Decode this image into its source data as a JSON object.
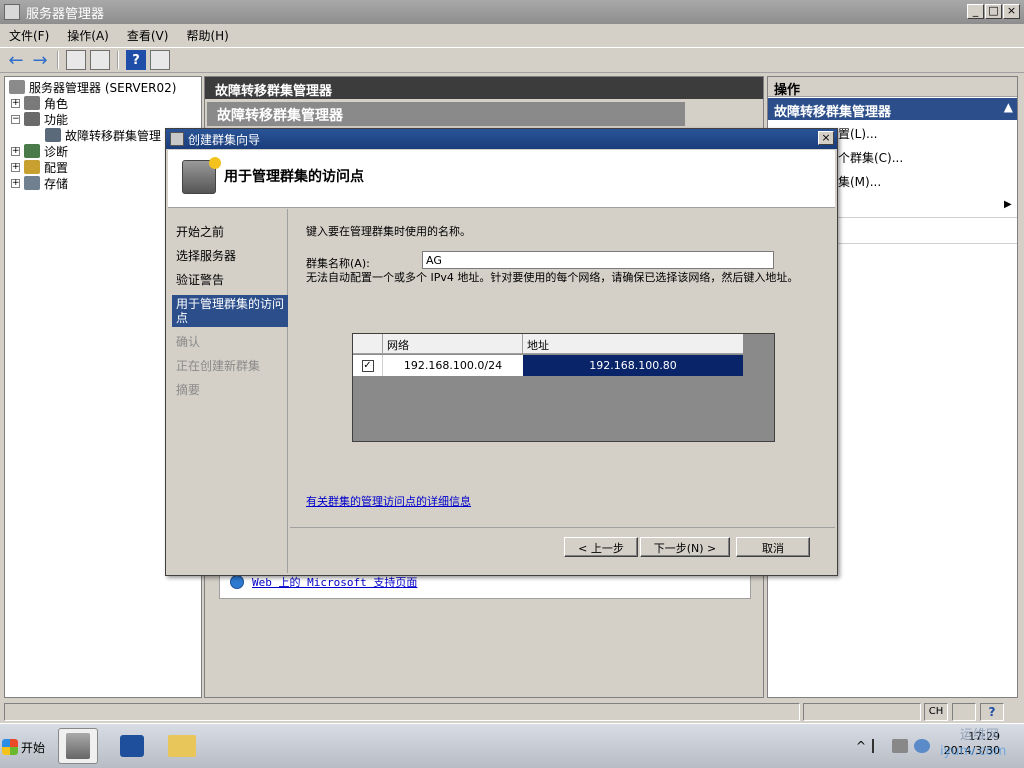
{
  "window": {
    "title": "服务器管理器",
    "controls": {
      "minimize": "_",
      "restore": "□",
      "close": "×"
    }
  },
  "menubar": {
    "items": [
      {
        "label": "文件(F)"
      },
      {
        "label": "操作(A)"
      },
      {
        "label": "查看(V)"
      },
      {
        "label": "帮助(H)"
      }
    ]
  },
  "toolbar": {
    "back_icon": "←",
    "forward_icon": "→",
    "help_icon": "?"
  },
  "tree": {
    "root": "服务器管理器 (SERVER02)",
    "items": [
      {
        "label": "角色",
        "expander": "+"
      },
      {
        "label": "功能",
        "expander": "−"
      },
      {
        "label": "故障转移群集管理",
        "expander": ""
      },
      {
        "label": "诊断",
        "expander": "+"
      },
      {
        "label": "配置",
        "expander": "+"
      },
      {
        "label": "存储",
        "expander": "+"
      }
    ]
  },
  "center": {
    "header": "故障转移群集管理器",
    "subheader": "故障转移群集管理器",
    "web_link": "Web 上的 Microsoft 支持页面"
  },
  "actions": {
    "header": "操作",
    "section": "故障转移群集管理器",
    "collapse_icon": "▲",
    "items": [
      {
        "label": "置(L)..."
      },
      {
        "label": "个群集(C)..."
      },
      {
        "label": "集(M)..."
      }
    ],
    "submenu_arrow": "▶"
  },
  "wizard": {
    "title": "创建群集向导",
    "close": "×",
    "header_title": "用于管理群集的访问点",
    "steps": [
      {
        "label": "开始之前"
      },
      {
        "label": "选择服务器"
      },
      {
        "label": "验证警告"
      },
      {
        "label": "用于管理群集的访问点"
      },
      {
        "label": "确认"
      },
      {
        "label": "正在创建新群集"
      },
      {
        "label": "摘要"
      }
    ],
    "instruction": "键入要在管理群集时使用的名称。",
    "name_label": "群集名称(A):",
    "name_value": "AG",
    "note": "无法自动配置一个或多个 IPv4 地址。针对要使用的每个网络，请确保已选择该网络，然后键入地址。",
    "table": {
      "columns": [
        "网络",
        "地址"
      ],
      "rows": [
        {
          "checked": "✓",
          "network": "192.168.100.0/24",
          "address": "192.168.100.80"
        }
      ]
    },
    "detail_link": "有关群集的管理访问点的详细信息",
    "buttons": {
      "prev": "< 上一步",
      "next": "下一步(N) >",
      "cancel": "取消"
    }
  },
  "statusbar": {
    "lang": "CH",
    "help_icon": "?"
  },
  "taskbar": {
    "start_label": "开始",
    "tray_chevron": "^",
    "clock_time": "17:29",
    "clock_date": "2014/3/30",
    "watermark1": "运维网",
    "watermark2": "iyunv.com"
  }
}
